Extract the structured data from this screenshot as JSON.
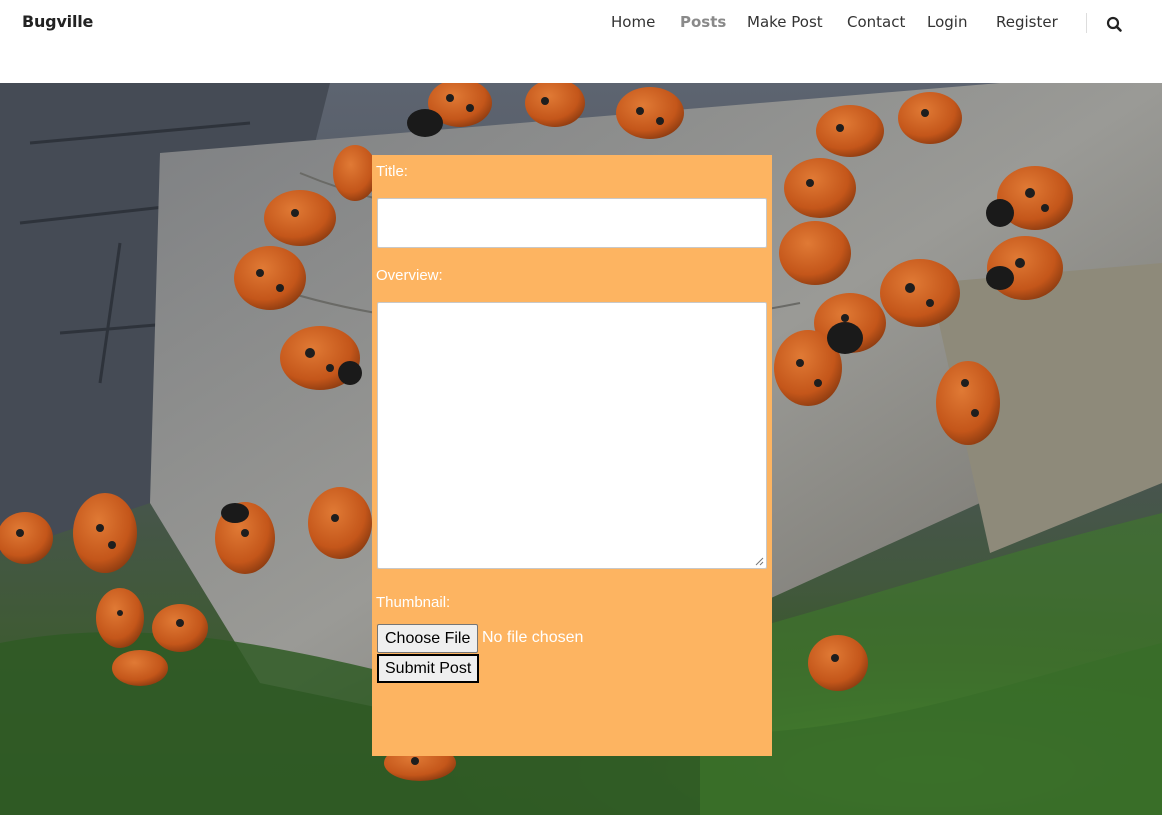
{
  "brand": "Bugville",
  "nav": {
    "items": [
      {
        "label": "Home",
        "active": false
      },
      {
        "label": "Posts",
        "active": true
      },
      {
        "label": "Make Post",
        "active": false
      },
      {
        "label": "Contact",
        "active": false
      },
      {
        "label": "Login",
        "active": false
      },
      {
        "label": "Register",
        "active": false
      }
    ],
    "search_icon": "search-icon"
  },
  "form": {
    "title_label": "Title:",
    "title_value": "",
    "overview_label": "Overview:",
    "overview_value": "",
    "thumbnail_label": "Thumbnail:",
    "choose_file_label": "Choose File",
    "no_file_text": "No file chosen",
    "submit_label": "Submit Post"
  },
  "colors": {
    "panel_bg": "#fdb461",
    "active_nav": "#8a8a8a"
  }
}
